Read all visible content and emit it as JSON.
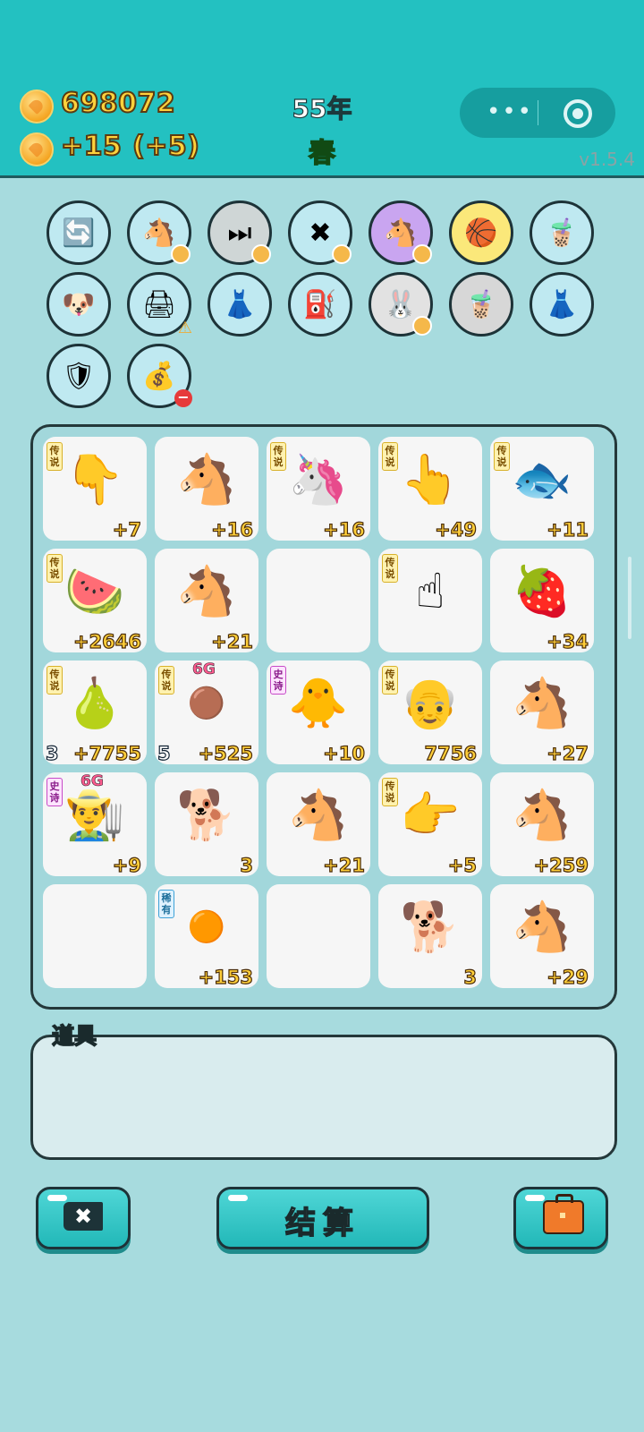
{
  "header": {
    "coins": "698072",
    "income": "+15",
    "income_bonus": "(+5)",
    "year": "55年",
    "season": "春",
    "menu_dots": "•••",
    "version": "v1.5.4"
  },
  "tools": [
    {
      "icon": "refresh",
      "glyph": "🔄",
      "bg": "#bfe9f1"
    },
    {
      "icon": "horse-pair",
      "glyph": "🐴",
      "bg": "#bfe9f1"
    },
    {
      "icon": "skip",
      "glyph": "⏭",
      "bg": "#cfd6d6"
    },
    {
      "icon": "delete-tag",
      "glyph": "✖",
      "bg": "#bfe9f1"
    },
    {
      "icon": "horse-pair-purple",
      "glyph": "🐴",
      "bg": "#c9a5f0"
    },
    {
      "icon": "basketballs",
      "glyph": "🏀",
      "bg": "#fbe87a"
    },
    {
      "icon": "milk-tea",
      "glyph": "🧋",
      "bg": "#bfe9f1"
    },
    {
      "icon": "dog",
      "glyph": "🐶",
      "bg": "#bfe9f1"
    },
    {
      "icon": "printer",
      "glyph": "🖨",
      "bg": "#bfe9f1"
    },
    {
      "icon": "skirt",
      "glyph": "👗",
      "bg": "#bfe9f1"
    },
    {
      "icon": "pump",
      "glyph": "⛽",
      "bg": "#bfe9f1"
    },
    {
      "icon": "rabbit",
      "glyph": "🐰",
      "bg": "#e2e2e2"
    },
    {
      "icon": "milk-tea",
      "glyph": "🧋",
      "bg": "#d7d7d7"
    },
    {
      "icon": "skirt",
      "glyph": "👗",
      "bg": "#bfe9f1"
    },
    {
      "icon": "shield-wrench",
      "glyph": "🛡",
      "bg": "#bfe9f1"
    },
    {
      "icon": "bag",
      "glyph": "💰",
      "bg": "#bfe9f1"
    }
  ],
  "board": [
    {
      "name": "pointing-down-hand",
      "emoji": "👇",
      "badge": "传说",
      "badge_type": "legend",
      "value": "+7"
    },
    {
      "name": "horse",
      "emoji": "🐴",
      "badge": "",
      "value": "+16"
    },
    {
      "name": "unicorn",
      "emoji": "🦄",
      "badge": "传说",
      "badge_type": "legend",
      "value": "+16"
    },
    {
      "name": "pointing-hand",
      "emoji": "👆",
      "badge": "传说",
      "badge_type": "legend",
      "value": "+49"
    },
    {
      "name": "koi-fish",
      "emoji": "🐟",
      "badge": "传说",
      "badge_type": "legend",
      "value": "+11"
    },
    {
      "name": "watermelon",
      "emoji": "🍉",
      "badge": "传说",
      "badge_type": "legend",
      "value": "+2646"
    },
    {
      "name": "horse",
      "emoji": "🐴",
      "badge": "",
      "value": "+21"
    },
    {
      "name": "empty",
      "emoji": "",
      "badge": "",
      "value": ""
    },
    {
      "name": "pointing-up-hand",
      "emoji": "☝",
      "badge": "传说",
      "badge_type": "legend",
      "value": ""
    },
    {
      "name": "horse-strawberry",
      "emoji": "🍓",
      "badge": "",
      "value": "+34"
    },
    {
      "name": "pomelo",
      "emoji": "🍐",
      "badge": "传说",
      "badge_type": "legend",
      "value": "+7755",
      "count": "3"
    },
    {
      "name": "longan",
      "emoji": "🟤",
      "badge": "传说",
      "badge_type": "legend",
      "value": "+525",
      "count": "5",
      "tag": "6G"
    },
    {
      "name": "chick-granny",
      "emoji": "🐥",
      "badge": "史诗",
      "badge_type": "epic",
      "value": "+10"
    },
    {
      "name": "bald-man",
      "emoji": "👴",
      "badge": "传说",
      "badge_type": "legend",
      "value": "7756"
    },
    {
      "name": "horse",
      "emoji": "🐴",
      "badge": "",
      "value": "+27"
    },
    {
      "name": "farmer",
      "emoji": "👨‍🌾",
      "badge": "史诗",
      "badge_type": "epic",
      "value": "+9",
      "tag": "6G"
    },
    {
      "name": "husky",
      "emoji": "🐕",
      "badge": "",
      "value": "3"
    },
    {
      "name": "horse",
      "emoji": "🐴",
      "badge": "",
      "value": "+21"
    },
    {
      "name": "pointing-right-hand",
      "emoji": "👉",
      "badge": "传说",
      "badge_type": "legend",
      "value": "+5"
    },
    {
      "name": "horse",
      "emoji": "🐴",
      "badge": "",
      "value": "+259"
    },
    {
      "name": "empty",
      "emoji": "",
      "badge": "",
      "value": ""
    },
    {
      "name": "orange",
      "emoji": "🟠",
      "badge": "稀有",
      "badge_type": "rare",
      "value": "+153"
    },
    {
      "name": "empty",
      "emoji": "",
      "badge": "",
      "value": ""
    },
    {
      "name": "husky",
      "emoji": "🐕",
      "badge": "",
      "value": "3"
    },
    {
      "name": "horse",
      "emoji": "🐴",
      "badge": "",
      "value": "+29"
    }
  ],
  "props": {
    "label": "道具"
  },
  "buttons": {
    "settle": "结算"
  }
}
